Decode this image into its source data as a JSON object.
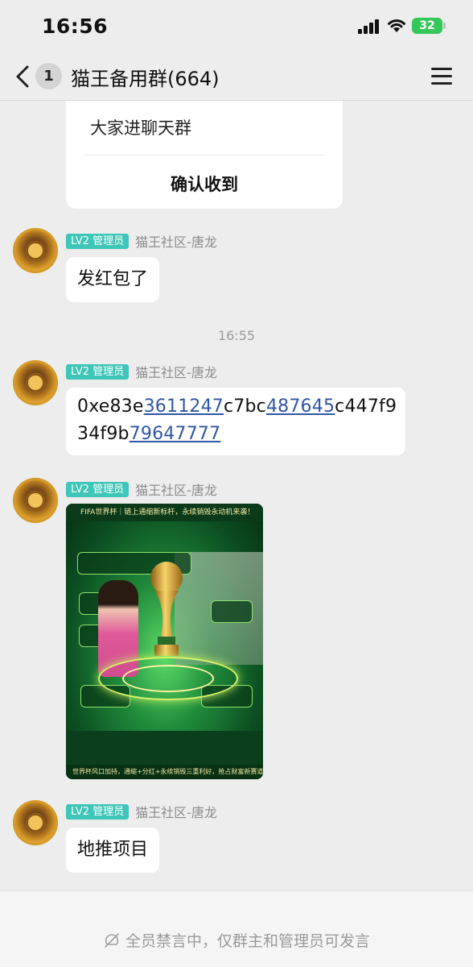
{
  "status": {
    "time": "16:56",
    "battery": "32"
  },
  "nav": {
    "unread": "1",
    "title": "猫王备用群(664)"
  },
  "card": {
    "text": "大家进聊天群",
    "button": "确认收到"
  },
  "messages": [
    {
      "level": "LV2 管理员",
      "sender": "猫王社区-唐龙",
      "text": "发红包了"
    },
    {
      "level": "LV2 管理员",
      "sender": "猫王社区-唐龙",
      "hash_parts": [
        "0xe83e",
        "3611247",
        "c7bc",
        "487645",
        "c447f9",
        "34f9b",
        "79647777"
      ]
    },
    {
      "level": "LV2 管理员",
      "sender": "猫王社区-唐龙"
    },
    {
      "level": "LV2 管理员",
      "sender": "猫王社区-唐龙",
      "text": "地推项目"
    }
  ],
  "timestamp": "16:55",
  "poster": {
    "headline": "FIFA世界杯｜链上通缩新标杆，永续销毁永动机来袭！",
    "footer_text": "世界杯风口加持，通缩+分红+永续销毁三重利好，抢占财富新赛道"
  },
  "footer": {
    "notice": "全员禁言中，仅群主和管理员可发言"
  },
  "colors": {
    "badge_teal": "#3ec6b8",
    "link_blue": "#2f57a4",
    "battery_green": "#34c759"
  }
}
